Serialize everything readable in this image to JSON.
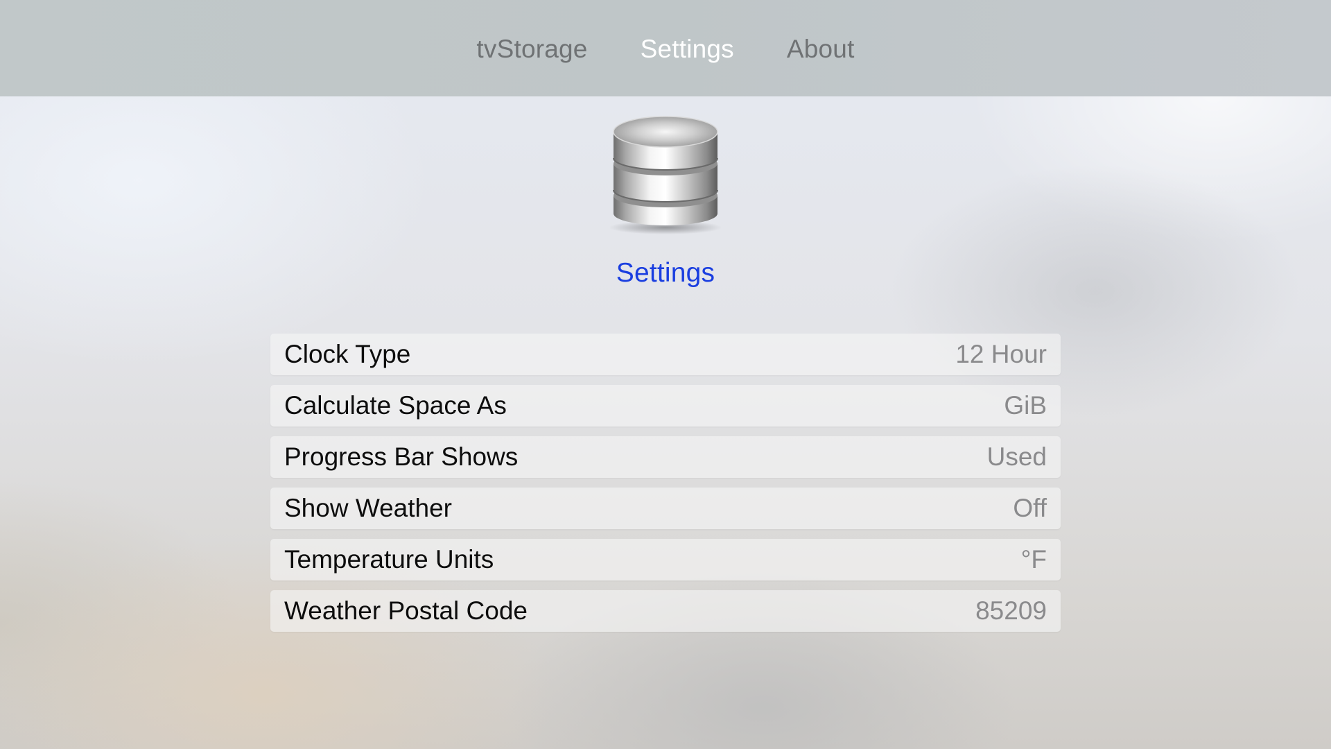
{
  "tabbar": {
    "tabs": [
      {
        "label": "tvStorage",
        "selected": false
      },
      {
        "label": "Settings",
        "selected": true
      },
      {
        "label": "About",
        "selected": false
      }
    ]
  },
  "header": {
    "icon": "database-icon",
    "title": "Settings"
  },
  "colors": {
    "title_accent": "#1a3ee0",
    "selected_tab": "#ffffff",
    "unselected_tab": "#6f7274",
    "value_text": "#8a8a8c"
  },
  "settings": [
    {
      "label": "Clock Type",
      "value": "12 Hour"
    },
    {
      "label": "Calculate Space As",
      "value": "GiB"
    },
    {
      "label": "Progress Bar Shows",
      "value": "Used"
    },
    {
      "label": "Show Weather",
      "value": "Off"
    },
    {
      "label": "Temperature Units",
      "value": "°F"
    },
    {
      "label": "Weather Postal Code",
      "value": "85209"
    }
  ]
}
